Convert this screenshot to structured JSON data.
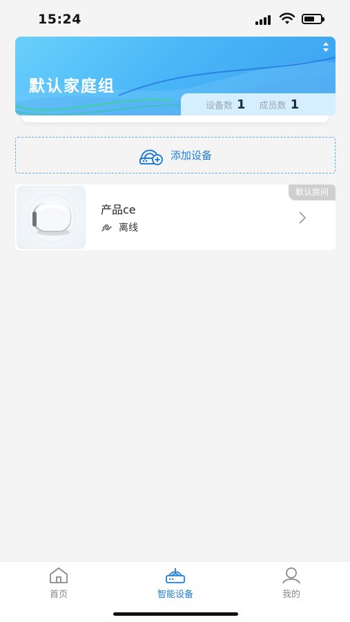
{
  "status_bar": {
    "time": "15:24"
  },
  "header": {
    "group_name": "默认家庭组",
    "device_count_label": "设备数",
    "device_count": "1",
    "member_count_label": "成员数",
    "member_count": "1"
  },
  "add_device": {
    "label": "添加设备"
  },
  "devices": [
    {
      "name": "产品ce",
      "status": "离线",
      "room": "默认房间"
    }
  ],
  "tabs": [
    {
      "label": "首页",
      "icon": "home-icon",
      "active": false
    },
    {
      "label": "智能设备",
      "icon": "router-icon",
      "active": true
    },
    {
      "label": "我的",
      "icon": "user-icon",
      "active": false
    }
  ],
  "colors": {
    "accent": "#1f7ed8",
    "header_gradient_start": "#6ad0fb",
    "header_gradient_end": "#3aa0ef",
    "background": "#f4f4f5"
  }
}
